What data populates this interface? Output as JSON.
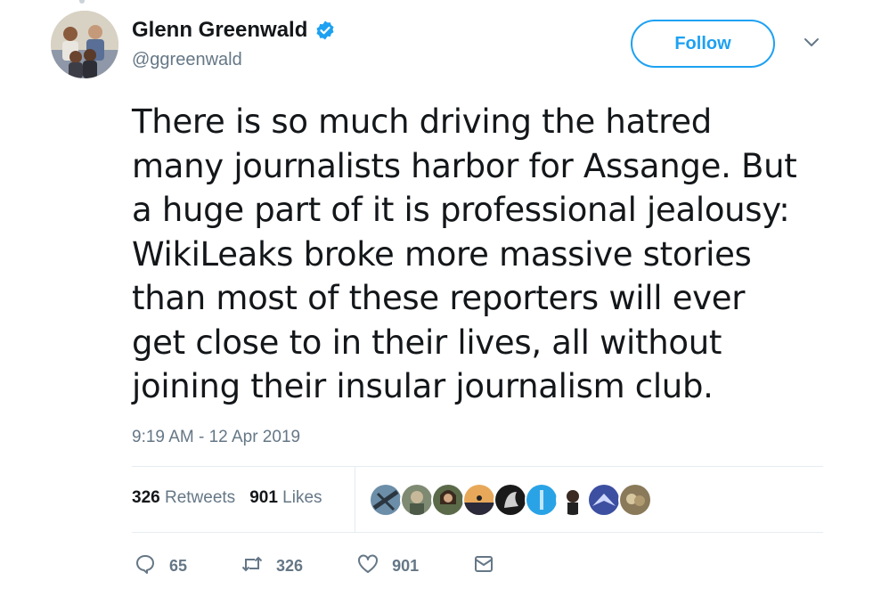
{
  "user": {
    "name": "Glenn Greenwald",
    "handle": "@ggreenwald",
    "verified": true
  },
  "follow_button": {
    "label": "Follow"
  },
  "icons": {
    "verified": "verified-badge-icon",
    "caret": "chevron-down-icon",
    "reply": "reply-icon",
    "retweet": "retweet-icon",
    "like": "heart-icon",
    "dm": "envelope-icon"
  },
  "tweet": {
    "lines": [
      "There is so much driving the hatred",
      "many journalists harbor for Assange. But",
      "a huge part of it is professional jealousy:",
      "WikiLeaks broke more massive stories",
      "than most of these reporters will ever",
      "get close to in their lives, all without",
      "joining their insular journalism club."
    ],
    "timestamp": "9:19 AM - 12 Apr 2019"
  },
  "stats": {
    "retweets": {
      "count": "326",
      "label": "Retweets"
    },
    "likes": {
      "count": "901",
      "label": "Likes"
    }
  },
  "actions": {
    "reply": "65",
    "retweet": "326",
    "like": "901"
  },
  "colors": {
    "accent": "#1da1f2",
    "text": "#14171a",
    "secondary": "#657786",
    "divider": "#e6ecf0"
  }
}
